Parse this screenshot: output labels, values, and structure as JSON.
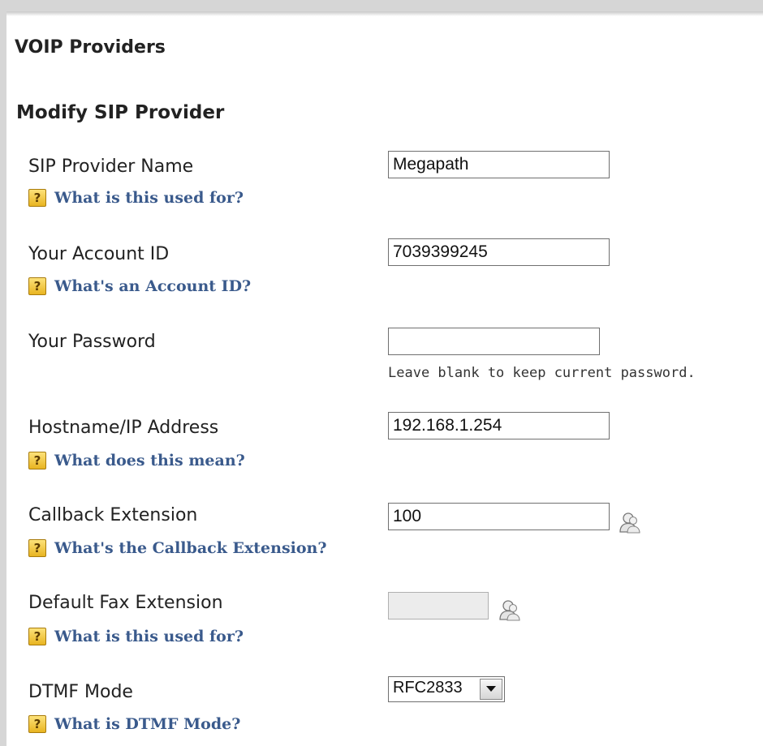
{
  "page": {
    "section_title": "VOIP Providers",
    "form_title": "Modify SIP Provider"
  },
  "fields": {
    "name": {
      "label": "SIP Provider Name",
      "help": "What is this used for?",
      "value": "Megapath"
    },
    "account": {
      "label": "Your Account ID",
      "help": "What's an Account ID?",
      "value": "7039399245"
    },
    "password": {
      "label": "Your Password",
      "value": "",
      "hint": "Leave blank to keep current password."
    },
    "hostname": {
      "label": "Hostname/IP Address",
      "help": "What does this mean?",
      "value": "192.168.1.254"
    },
    "callback": {
      "label": "Callback Extension",
      "help": "What's the Callback Extension?",
      "value": "100",
      "icon": "user-lookup-icon"
    },
    "fax": {
      "label": "Default Fax Extension",
      "help": "What is this used for?",
      "value": "",
      "icon": "user-lookup-icon"
    },
    "dtmf": {
      "label": "DTMF Mode",
      "help": "What is DTMF Mode?",
      "selected": "RFC2833"
    }
  },
  "colors": {
    "help_link": "#3a5a8c",
    "help_icon": "#e8b421",
    "frame": "#d6d6d6"
  }
}
